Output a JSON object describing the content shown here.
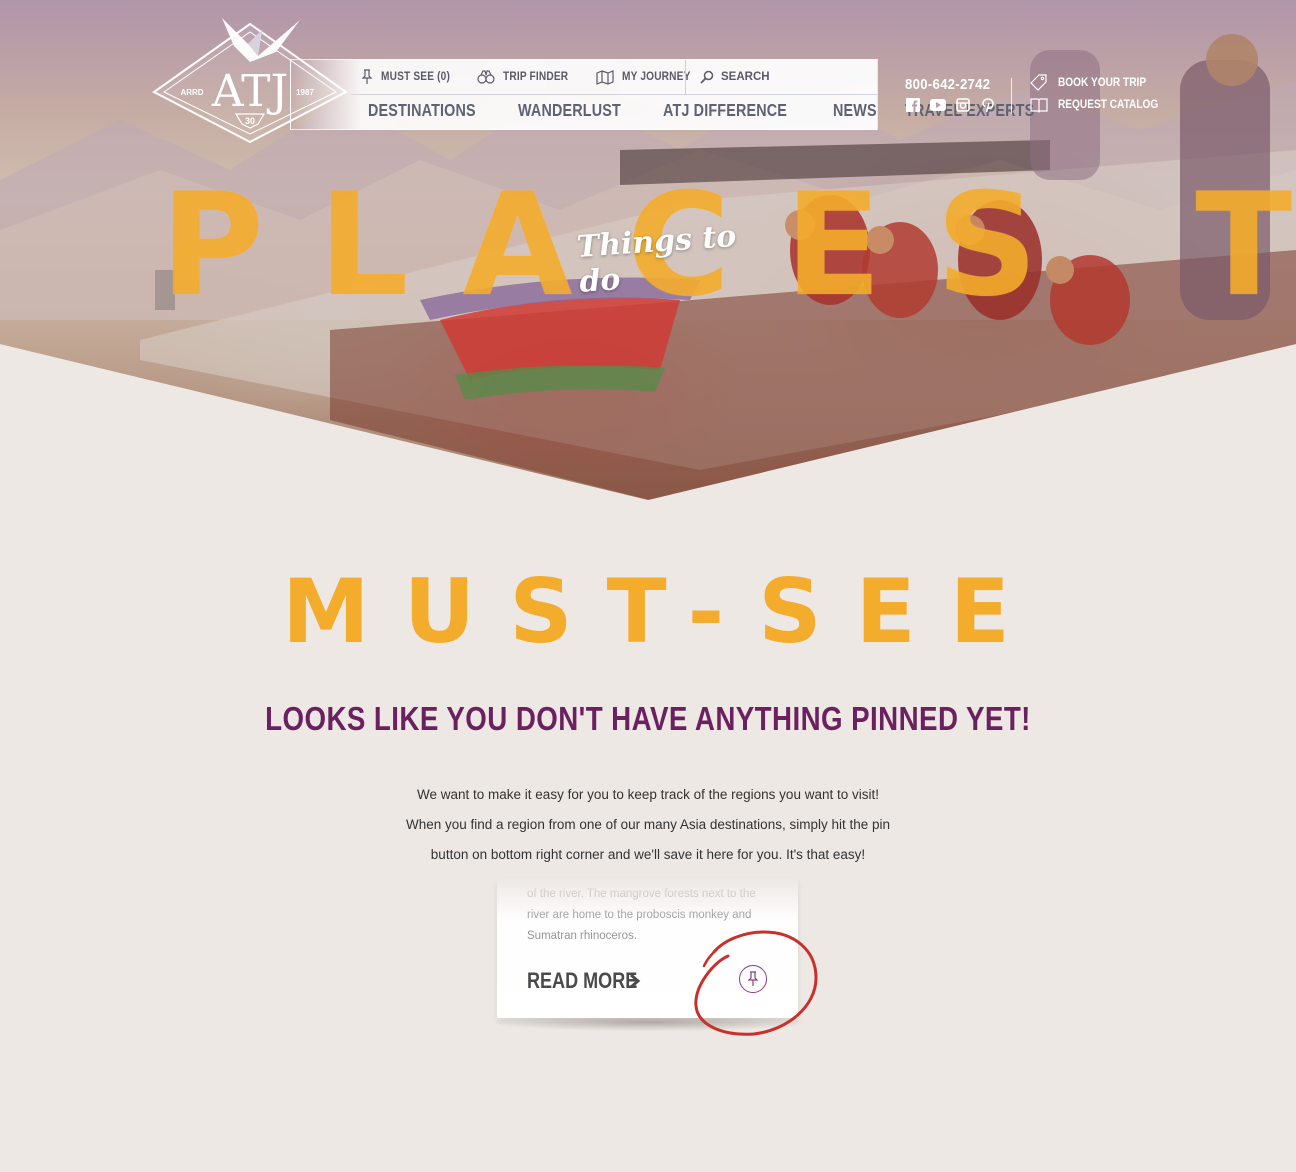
{
  "brand": {
    "logo_text": "ATJ",
    "logo_left": "ARRD",
    "logo_right": "1987",
    "logo_badge": "30"
  },
  "utility_nav": {
    "must_see": "MUST SEE (0)",
    "trip_finder": "TRIP FINDER",
    "my_journey": "MY JOURNEY",
    "search_placeholder": "SEARCH"
  },
  "main_nav": [
    "DESTINATIONS",
    "WANDERLUST",
    "ATJ DIFFERENCE",
    "NEWS",
    "TRAVEL EXPERTS"
  ],
  "contact": {
    "phone": "800-642-2742",
    "social_icons": [
      "facebook-icon",
      "youtube-icon",
      "instagram-icon",
      "pinterest-icon"
    ]
  },
  "cta": {
    "book": "BOOK YOUR TRIP",
    "catalog": "REQUEST CATALOG"
  },
  "hero": {
    "title": "PLACES TO GO",
    "subtitle": "Things to do"
  },
  "section": {
    "title": "MUST-SEE",
    "empty_heading": "LOOKS LIKE YOU DON'T HAVE ANYTHING PINNED YET!",
    "empty_body": "We want to make it easy for you to keep track of the regions you want to visit! When you find a region from one of our many Asia destinations, simply hit the pin button on bottom right corner and we'll save it here for you. It's that easy!"
  },
  "card": {
    "excerpt": "of the river. The mangrove forests next to the river are home to the proboscis monkey and Sumatran rhinoceros.",
    "read_more": "READ MORE"
  },
  "colors": {
    "accent_orange": "#f4ac2c",
    "heading_purple": "#6b2060",
    "nav_text": "#5d6275",
    "annotation_red": "#c8312b",
    "background": "#ede8e4"
  }
}
